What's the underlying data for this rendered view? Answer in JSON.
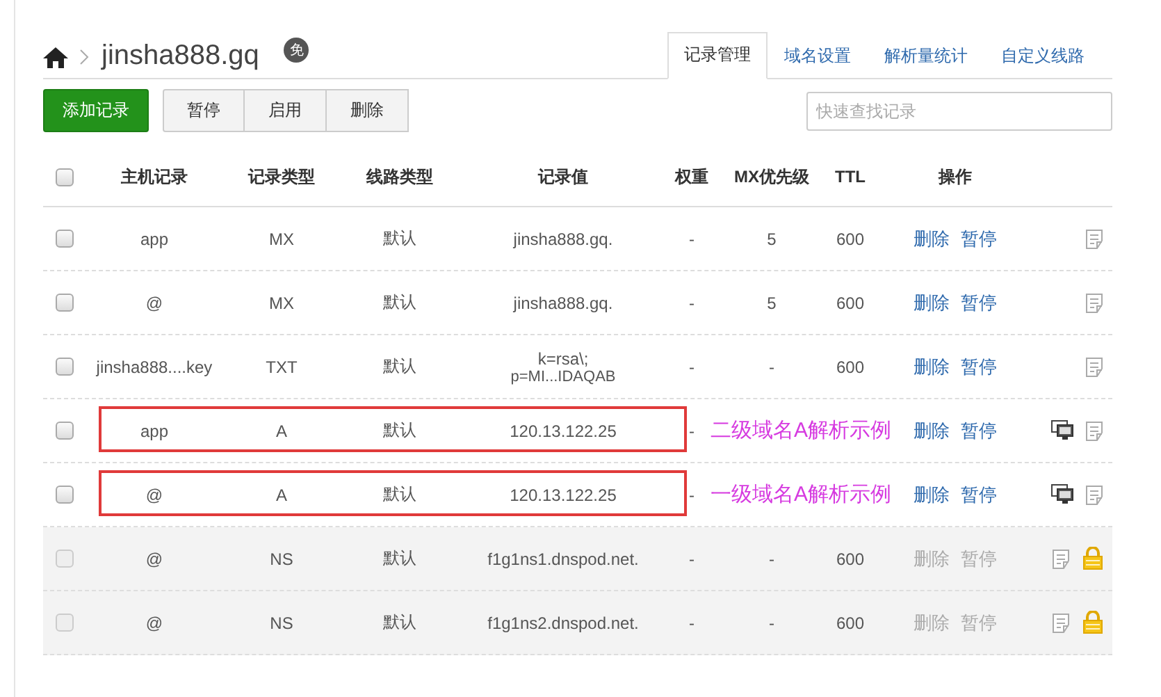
{
  "breadcrumb": {
    "domain": "jinsha888.gq",
    "badge": "免"
  },
  "tabs": [
    {
      "label": "记录管理",
      "selected": true
    },
    {
      "label": "域名设置",
      "selected": false
    },
    {
      "label": "解析量统计",
      "selected": false
    },
    {
      "label": "自定义线路",
      "selected": false
    }
  ],
  "buttons": [
    {
      "label": "添加记录",
      "kind": "primary"
    },
    {
      "label": "暂停",
      "kind": "group"
    },
    {
      "label": "启用",
      "kind": "group"
    },
    {
      "label": "删除",
      "kind": "group"
    }
  ],
  "search": {
    "placeholder": "快速查找记录"
  },
  "table": {
    "header_checked": false,
    "columns": [
      "主机记录",
      "记录类型",
      "线路类型",
      "记录值",
      "权重",
      "MX优先级",
      "TTL",
      "操作"
    ],
    "rows": [
      {
        "checked": false,
        "disabled": false,
        "host": "app",
        "type": "MX",
        "line": "默认",
        "value": "jinsha888.gq.",
        "weight": "-",
        "mx": "5",
        "ttl": "600",
        "actions": [
          "删除",
          "暂停"
        ],
        "monitor": false,
        "locked": false
      },
      {
        "checked": false,
        "disabled": false,
        "host": "@",
        "type": "MX",
        "line": "默认",
        "value": "jinsha888.gq.",
        "weight": "-",
        "mx": "5",
        "ttl": "600",
        "actions": [
          "删除",
          "暂停"
        ],
        "monitor": false,
        "locked": false
      },
      {
        "checked": false,
        "disabled": false,
        "host": "jinsha888....key",
        "type": "TXT",
        "line": "默认",
        "value": "k=rsa\\;",
        "value_more": "p=MI...IDAQAB",
        "weight": "-",
        "mx": "-",
        "ttl": "600",
        "actions": [
          "删除",
          "暂停"
        ],
        "monitor": false,
        "locked": false
      },
      {
        "checked": false,
        "disabled": false,
        "host": "app",
        "type": "A",
        "line": "默认",
        "value": "120.13.122.25",
        "weight": "-",
        "actions": [
          "删除",
          "暂停"
        ],
        "monitor": true,
        "locked": false,
        "annotation": {
          "text": "二级域名A解析示例"
        }
      },
      {
        "checked": false,
        "disabled": false,
        "host": "@",
        "type": "A",
        "line": "默认",
        "value": "120.13.122.25",
        "weight": "-",
        "actions": [
          "删除",
          "暂停"
        ],
        "monitor": true,
        "locked": false,
        "annotation": {
          "text": "一级域名A解析示例"
        }
      },
      {
        "checked": false,
        "disabled": true,
        "host": "@",
        "type": "NS",
        "line": "默认",
        "value": "f1g1ns1.dnspod.net.",
        "weight": "-",
        "mx": "-",
        "ttl": "600",
        "actions": [
          "删除",
          "暂停"
        ],
        "monitor": false,
        "locked": true
      },
      {
        "checked": false,
        "disabled": true,
        "host": "@",
        "type": "NS",
        "line": "默认",
        "value": "f1g1ns2.dnspod.net.",
        "weight": "-",
        "mx": "-",
        "ttl": "600",
        "actions": [
          "删除",
          "暂停"
        ],
        "monitor": false,
        "locked": true
      }
    ]
  }
}
